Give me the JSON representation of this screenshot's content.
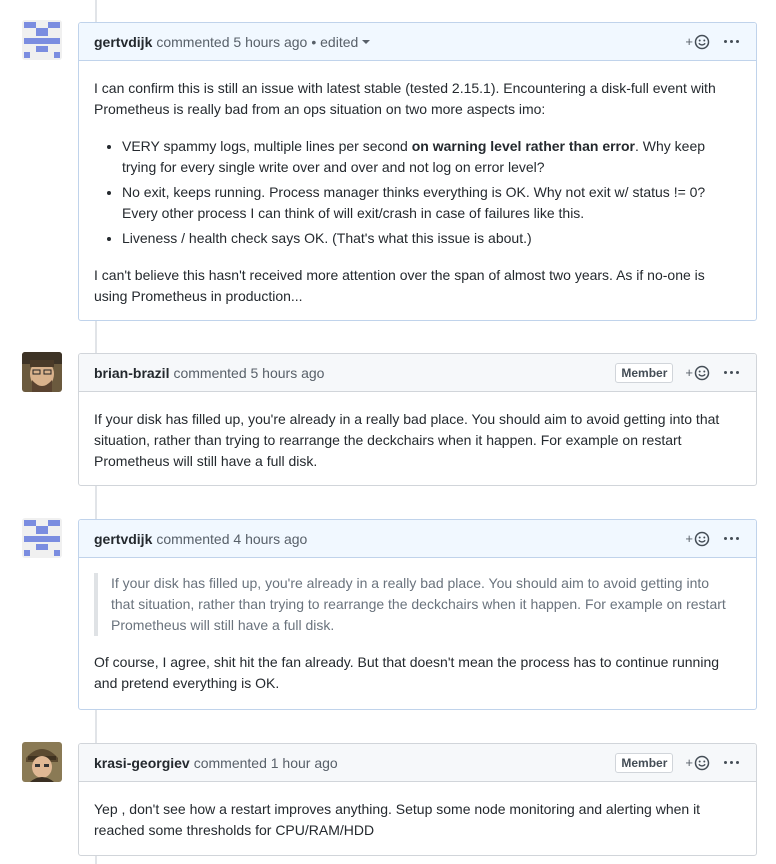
{
  "comments": [
    {
      "author": "gertvdijk",
      "meta": "commented 5 hours ago",
      "edited": "• edited",
      "badge": "",
      "paragraphs": [
        "I can confirm this is still an issue with latest stable (tested 2.15.1). Encountering a disk-full event with Prometheus is really bad from an ops situation on two more aspects imo:",
        "I can't believe this hasn't received more attention over the span of almost two years. As if no-one is using Prometheus in production..."
      ],
      "list": [
        {
          "pre": "VERY spammy logs, multiple lines per second ",
          "bold": "on warning level rather than error",
          "post": ". Why keep trying for every single write over and over and not log on error level?"
        },
        {
          "pre": "No exit, keeps running. Process manager thinks everything is OK. Why not exit w/ status != 0? Every other process I can think of will exit/crash in case of failures like this.",
          "bold": "",
          "post": ""
        },
        {
          "pre": "Liveness / health check says OK. (That's what this issue is about.)",
          "bold": "",
          "post": ""
        }
      ]
    },
    {
      "author": "brian-brazil",
      "meta": "commented 5 hours ago",
      "badge": "Member",
      "paragraphs": [
        "If your disk has filled up, you're already in a really bad place. You should aim to avoid getting into that situation, rather than trying to rearrange the deckchairs when it happen. For example on restart Prometheus will still have a full disk."
      ]
    },
    {
      "author": "gertvdijk",
      "meta": "commented 4 hours ago",
      "badge": "",
      "quote": "If your disk has filled up, you're already in a really bad place. You should aim to avoid getting into that situation, rather than trying to rearrange the deckchairs when it happen. For example on restart Prometheus will still have a full disk.",
      "paragraphs": [
        "Of course, I agree, shit hit the fan already. But that doesn't mean the process has to continue running and pretend everything is OK."
      ]
    },
    {
      "author": "krasi-georgiev",
      "meta": "commented 1 hour ago",
      "badge": "Member",
      "paragraphs": [
        "Yep , don't see how a restart improves anything. Setup some node monitoring and alerting when it reached some thresholds for CPU/RAM/HDD"
      ]
    }
  ],
  "icons": {
    "react": "smiley-icon",
    "more": "kebab-horizontal-icon"
  },
  "reaction_plus": "+",
  "colors": {
    "own_header_bg": "#f1f8ff",
    "own_border": "#c0d3eb",
    "other_header_bg": "#f6f8fa",
    "identicon": "#7b8de0"
  }
}
